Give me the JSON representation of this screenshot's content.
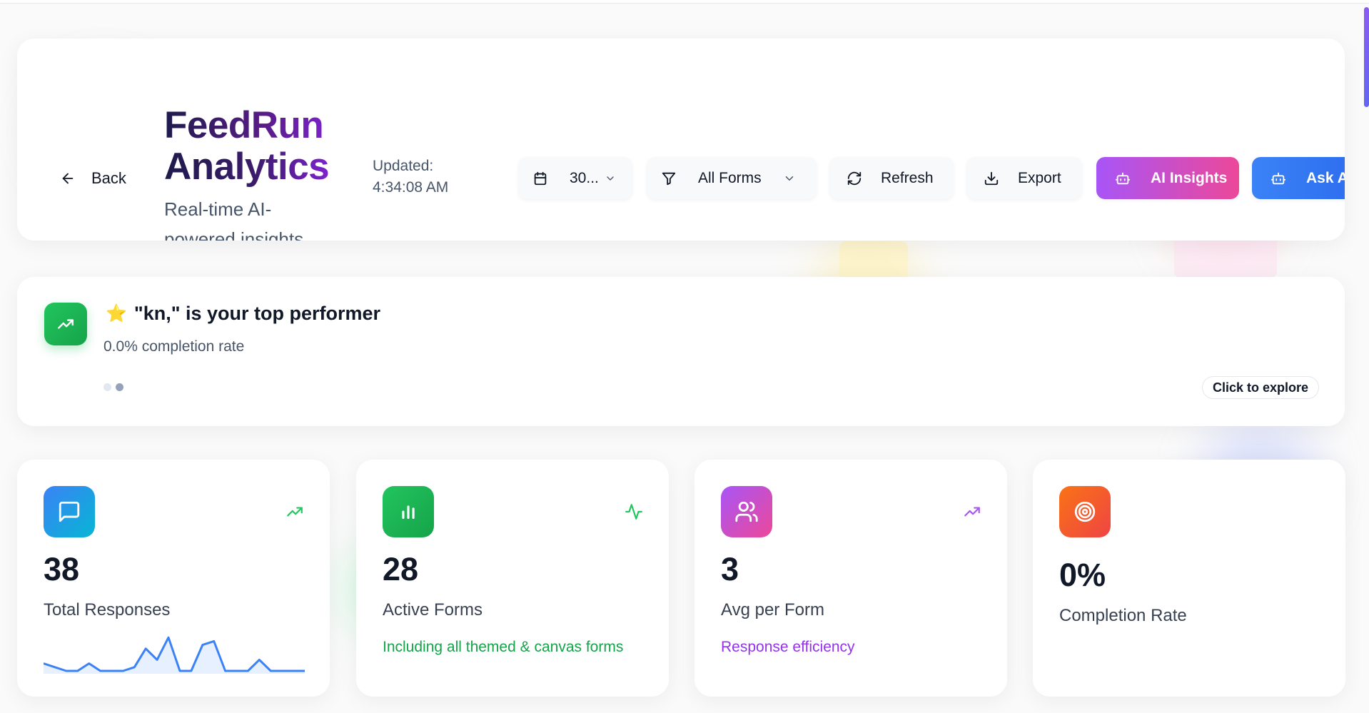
{
  "header": {
    "back_label": "Back",
    "title_line1": "FeedRun",
    "title_line2": "Analytics",
    "subtitle": "Real-time AI-powered insights",
    "updated_label": "Updated:",
    "updated_time": "4:34:08 AM",
    "date_range": "30...",
    "forms_filter": "All Forms",
    "refresh_label": "Refresh",
    "export_label": "Export",
    "ai_insights_label": "AI Insights",
    "ask_label": "Ask Avid"
  },
  "highlight": {
    "emoji": "⭐",
    "title": "\"kn,\" is your top performer",
    "subtitle": "0.0% completion rate",
    "explore_label": "Click to explore",
    "active_dot": 1
  },
  "stats": [
    {
      "icon": "message-square-icon",
      "trend_icon": "trending-up-icon",
      "value": "38",
      "label": "Total Responses",
      "note": "",
      "gradient": [
        "#3b82f6",
        "#06b6d4"
      ],
      "trend_color": "#22c55e"
    },
    {
      "icon": "bar-chart-icon",
      "trend_icon": "activity-icon",
      "value": "28",
      "label": "Active Forms",
      "note": "Including all themed & canvas forms",
      "gradient": [
        "#22c55e",
        "#16a34a"
      ],
      "trend_color": "#22c55e",
      "note_color": "#16a34a"
    },
    {
      "icon": "users-icon",
      "trend_icon": "trending-up-icon",
      "value": "3",
      "label": "Avg per Form",
      "note": "Response efficiency",
      "gradient": [
        "#a855f7",
        "#ec4899"
      ],
      "trend_color": "#a855f7",
      "note_color": "#9333ea"
    },
    {
      "icon": "target-icon",
      "value": "0%",
      "label": "Completion Rate",
      "note": "",
      "gradient": [
        "#f97316",
        "#ef4444"
      ]
    }
  ],
  "sparkline": {
    "values": [
      2,
      1,
      0,
      0,
      2,
      0,
      0,
      0,
      1,
      6,
      3,
      9,
      0,
      0,
      7,
      8,
      0,
      0,
      0,
      3,
      0,
      0,
      0,
      0
    ],
    "max": 10,
    "color": "#3b82f6"
  },
  "colors": {
    "brand_purple": "#7e22ce",
    "ai_gradient": [
      "#a855f7",
      "#ec4899"
    ],
    "ask_gradient": [
      "#3b82f6",
      "#2563eb"
    ]
  }
}
